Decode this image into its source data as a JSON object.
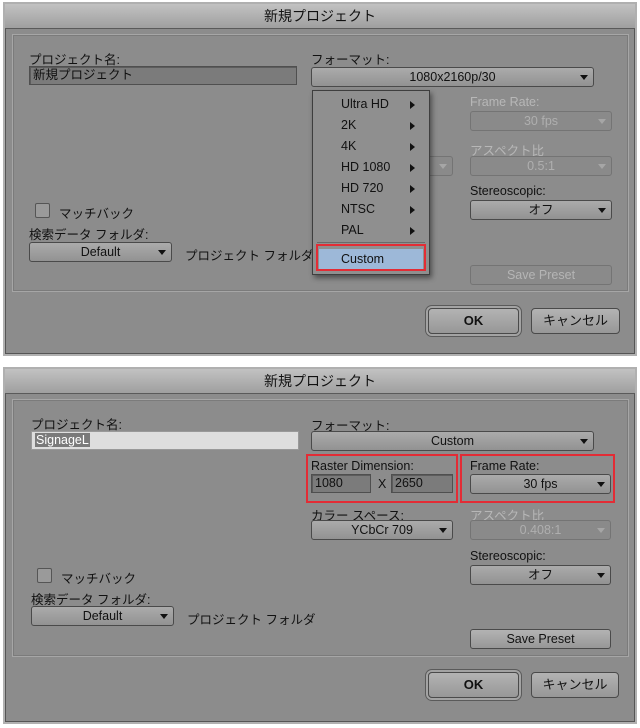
{
  "top_dialog": {
    "title": "新規プロジェクト",
    "project_name_label": "プロジェクト名:",
    "project_name_value": "新規プロジェクト",
    "format_label": "フォーマット:",
    "format_value": "1080x2160p/30",
    "frame_rate_label": "Frame Rate:",
    "frame_rate_value": "30 fps",
    "aspect_label": "アスペクト比",
    "aspect_value": "0.5:1",
    "stereo_label": "Stereoscopic:",
    "stereo_value": "オフ",
    "matchback_label": "マッチバック",
    "search_folder_label": "検索データ フォルダ:",
    "search_folder_value": "Default",
    "project_folder_label": "プロジェクト フォルダ",
    "save_preset_label": "Save Preset",
    "ok_label": "OK",
    "cancel_label": "キャンセル",
    "menu": {
      "items": [
        "Ultra HD",
        "2K",
        "4K",
        "HD 1080",
        "HD 720",
        "NTSC",
        "PAL"
      ],
      "custom": "Custom"
    }
  },
  "bottom_dialog": {
    "title": "新規プロジェクト",
    "project_name_label": "プロジェクト名:",
    "project_name_value": "SignageL",
    "format_label": "フォーマット:",
    "format_value": "Custom",
    "raster_label": "Raster Dimension:",
    "raster_width": "1080",
    "raster_x": "X",
    "raster_height": "2650",
    "frame_rate_label": "Frame Rate:",
    "frame_rate_value": "30 fps",
    "color_space_label": "カラー スペース:",
    "color_space_value": "YCbCr 709",
    "aspect_label": "アスペクト比",
    "aspect_value": "0.408:1",
    "stereo_label": "Stereoscopic:",
    "stereo_value": "オフ",
    "matchback_label": "マッチバック",
    "search_folder_label": "検索データ フォルダ:",
    "search_folder_value": "Default",
    "project_folder_label": "プロジェクト フォルダ",
    "save_preset_label": "Save Preset",
    "ok_label": "OK",
    "cancel_label": "キャンセル"
  },
  "colors": {
    "dialog_bg": "#8c8c8c",
    "highlight_red": "#e32c35",
    "menu_selected": "#9db8d8"
  }
}
